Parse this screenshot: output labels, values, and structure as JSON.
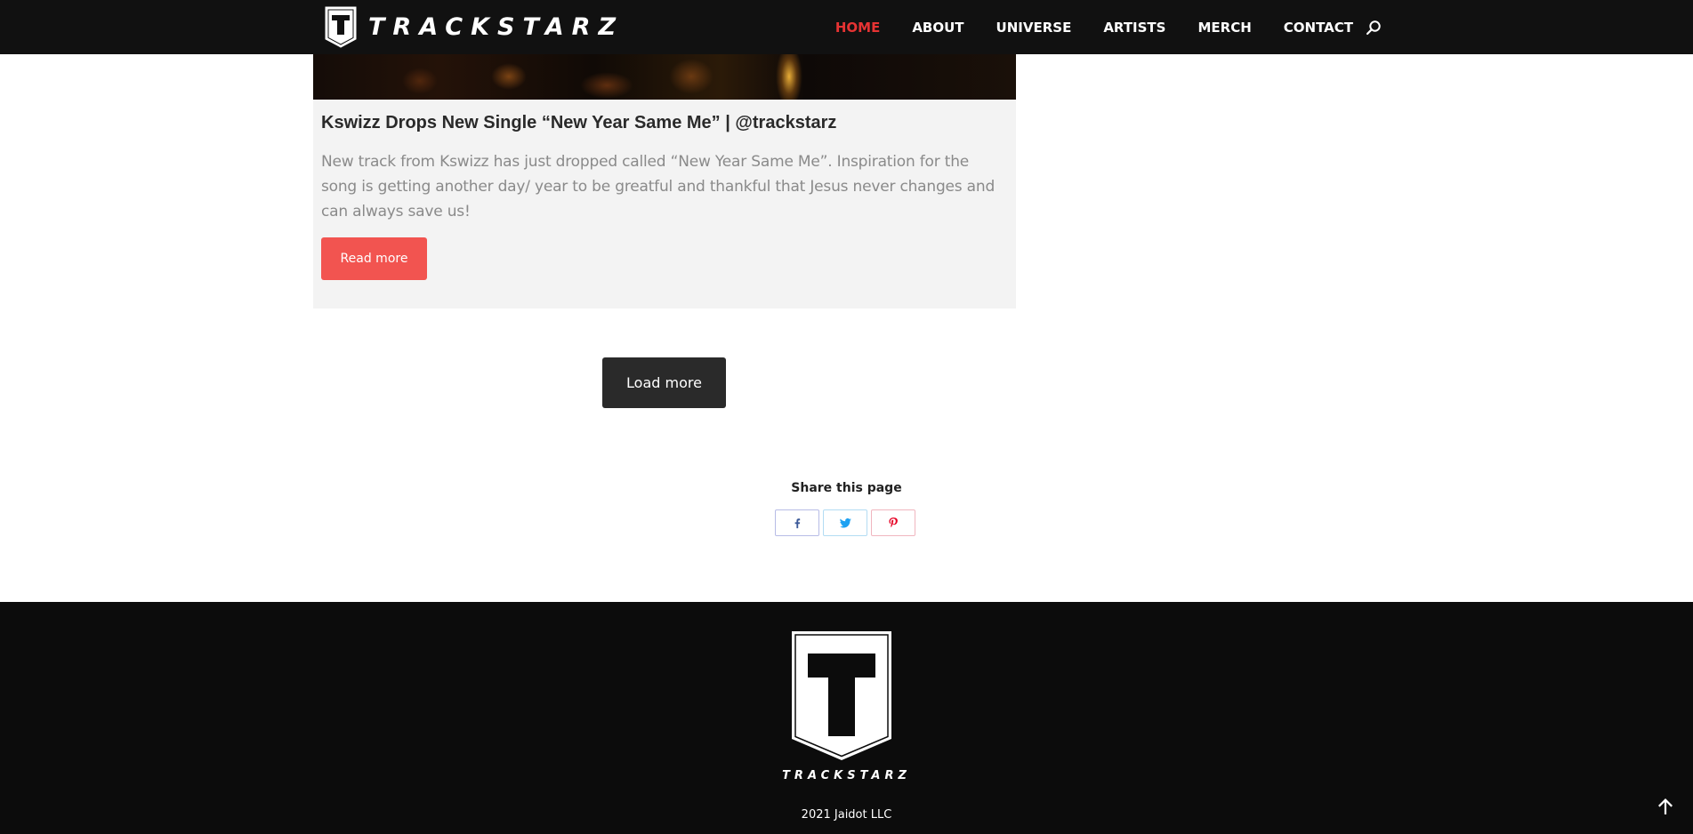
{
  "brand": {
    "name": "TRACKSTARZ"
  },
  "nav": {
    "items": [
      {
        "label": "HOME",
        "active": true
      },
      {
        "label": "ABOUT"
      },
      {
        "label": "UNIVERSE"
      },
      {
        "label": "ARTISTS"
      },
      {
        "label": "MERCH"
      },
      {
        "label": "CONTACT"
      }
    ],
    "search_icon": "search-icon"
  },
  "post": {
    "title": "Kswizz Drops New Single “New Year Same Me” | @trackstarz",
    "excerpt": "New track from Kswizz has just dropped called “New Year Same Me”. Inspiration for the song is getting another day/ year to be greatful and thankful that Jesus never changes and can always save us!",
    "read_more_label": "Read more"
  },
  "load_more_label": "Load more",
  "share": {
    "title": "Share this page",
    "buttons": [
      {
        "icon": "facebook-icon",
        "color": "#3b5998"
      },
      {
        "icon": "twitter-icon",
        "color": "#1da1f2"
      },
      {
        "icon": "pinterest-icon",
        "color": "#e60023"
      }
    ]
  },
  "footer": {
    "brand": "TRACKSTARZ",
    "copyright": "2021 Jaidot LLC"
  },
  "colors": {
    "accent": "#f25450",
    "nav_active": "#e63333",
    "header_bg": "#111111",
    "footer_bg": "#0c0c0c"
  }
}
